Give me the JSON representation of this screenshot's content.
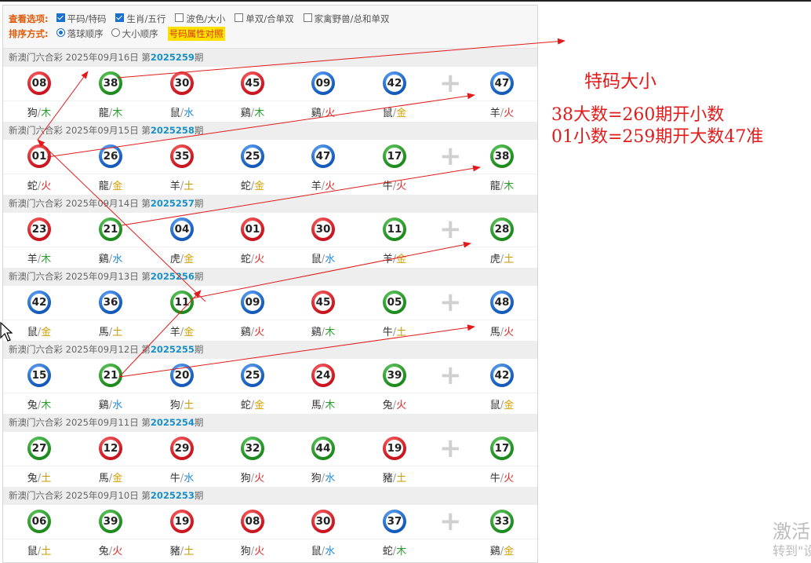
{
  "options": {
    "view_label": "查看选项:",
    "view_items": [
      {
        "label": "平码/特码",
        "checked": true
      },
      {
        "label": "生肖/五行",
        "checked": true
      },
      {
        "label": "波色/大小",
        "checked": false
      },
      {
        "label": "单双/合单双",
        "checked": false
      },
      {
        "label": "家禽野兽/总和单双",
        "checked": false
      }
    ],
    "sort_label": "排序方式:",
    "sort_items": [
      {
        "label": "落球顺序",
        "selected": true
      },
      {
        "label": "大小顺序",
        "selected": false
      }
    ],
    "compare_button": "号码属性对照"
  },
  "draws": [
    {
      "title": "新澳门六合彩 2025年09月16日 第",
      "period": "2025259",
      "suffix": "期",
      "balls": [
        [
          "08",
          "red"
        ],
        [
          "38",
          "green"
        ],
        [
          "30",
          "red"
        ],
        [
          "45",
          "red"
        ],
        [
          "09",
          "blue"
        ],
        [
          "42",
          "blue"
        ],
        [
          "47",
          "blue"
        ]
      ],
      "zodiacs": [
        [
          "狗",
          "木"
        ],
        [
          "龍",
          "木"
        ],
        [
          "鼠",
          "水"
        ],
        [
          "鷄",
          "木"
        ],
        [
          "鷄",
          "火"
        ],
        [
          "鼠",
          "金"
        ],
        [
          "羊",
          "火"
        ]
      ]
    },
    {
      "title": "新澳门六合彩 2025年09月15日 第",
      "period": "2025258",
      "suffix": "期",
      "balls": [
        [
          "01",
          "red"
        ],
        [
          "26",
          "blue"
        ],
        [
          "35",
          "red"
        ],
        [
          "25",
          "blue"
        ],
        [
          "47",
          "blue"
        ],
        [
          "17",
          "green"
        ],
        [
          "38",
          "green"
        ]
      ],
      "zodiacs": [
        [
          "蛇",
          "火"
        ],
        [
          "龍",
          "金"
        ],
        [
          "羊",
          "土"
        ],
        [
          "蛇",
          "金"
        ],
        [
          "羊",
          "火"
        ],
        [
          "牛",
          "火"
        ],
        [
          "龍",
          "木"
        ]
      ]
    },
    {
      "title": "新澳门六合彩 2025年09月14日 第",
      "period": "2025257",
      "suffix": "期",
      "balls": [
        [
          "23",
          "red"
        ],
        [
          "21",
          "green"
        ],
        [
          "04",
          "blue"
        ],
        [
          "01",
          "red"
        ],
        [
          "30",
          "red"
        ],
        [
          "11",
          "green"
        ],
        [
          "28",
          "green"
        ]
      ],
      "zodiacs": [
        [
          "羊",
          "木"
        ],
        [
          "鷄",
          "水"
        ],
        [
          "虎",
          "金"
        ],
        [
          "蛇",
          "火"
        ],
        [
          "鼠",
          "水"
        ],
        [
          "羊",
          "金"
        ],
        [
          "虎",
          "土"
        ]
      ]
    },
    {
      "title": "新澳门六合彩 2025年09月13日 第",
      "period": "2025256",
      "suffix": "期",
      "balls": [
        [
          "42",
          "blue"
        ],
        [
          "36",
          "blue"
        ],
        [
          "11",
          "green"
        ],
        [
          "09",
          "blue"
        ],
        [
          "45",
          "red"
        ],
        [
          "05",
          "green"
        ],
        [
          "48",
          "blue"
        ]
      ],
      "zodiacs": [
        [
          "鼠",
          "金"
        ],
        [
          "馬",
          "土"
        ],
        [
          "羊",
          "金"
        ],
        [
          "鷄",
          "火"
        ],
        [
          "鷄",
          "木"
        ],
        [
          "牛",
          "土"
        ],
        [
          "馬",
          "火"
        ]
      ]
    },
    {
      "title": "新澳门六合彩 2025年09月12日 第",
      "period": "2025255",
      "suffix": "期",
      "balls": [
        [
          "15",
          "blue"
        ],
        [
          "21",
          "green"
        ],
        [
          "20",
          "blue"
        ],
        [
          "25",
          "blue"
        ],
        [
          "24",
          "red"
        ],
        [
          "39",
          "green"
        ],
        [
          "42",
          "blue"
        ]
      ],
      "zodiacs": [
        [
          "兔",
          "木"
        ],
        [
          "鷄",
          "水"
        ],
        [
          "狗",
          "土"
        ],
        [
          "蛇",
          "金"
        ],
        [
          "馬",
          "木"
        ],
        [
          "兔",
          "火"
        ],
        [
          "鼠",
          "金"
        ]
      ]
    },
    {
      "title": "新澳门六合彩 2025年09月11日 第",
      "period": "2025254",
      "suffix": "期",
      "balls": [
        [
          "27",
          "green"
        ],
        [
          "12",
          "red"
        ],
        [
          "29",
          "red"
        ],
        [
          "32",
          "green"
        ],
        [
          "44",
          "green"
        ],
        [
          "19",
          "red"
        ],
        [
          "17",
          "green"
        ]
      ],
      "zodiacs": [
        [
          "兔",
          "土"
        ],
        [
          "馬",
          "金"
        ],
        [
          "牛",
          "水"
        ],
        [
          "狗",
          "火"
        ],
        [
          "狗",
          "水"
        ],
        [
          "豬",
          "土"
        ],
        [
          "牛",
          "火"
        ]
      ]
    },
    {
      "title": "新澳门六合彩 2025年09月10日 第",
      "period": "2025253",
      "suffix": "期",
      "balls": [
        [
          "06",
          "green"
        ],
        [
          "39",
          "green"
        ],
        [
          "19",
          "red"
        ],
        [
          "08",
          "red"
        ],
        [
          "30",
          "red"
        ],
        [
          "37",
          "blue"
        ],
        [
          "33",
          "green"
        ]
      ],
      "zodiacs": [
        [
          "鼠",
          "土"
        ],
        [
          "兔",
          "火"
        ],
        [
          "豬",
          "土"
        ],
        [
          "狗",
          "火"
        ],
        [
          "鼠",
          "水"
        ],
        [
          "蛇",
          "木"
        ],
        [
          "鷄",
          "金"
        ]
      ]
    }
  ],
  "element_colors": {
    "金": "#d4a000",
    "木": "#2a9d2a",
    "水": "#1e88d8",
    "火": "#e02424",
    "土": "#c79a00"
  },
  "annotation": {
    "title": "特码大小",
    "line1": "38大数=260期开小数",
    "line2": "01小数=259期开大数47准"
  },
  "watermark": {
    "line1": "激活",
    "line2": "转到\"设"
  }
}
